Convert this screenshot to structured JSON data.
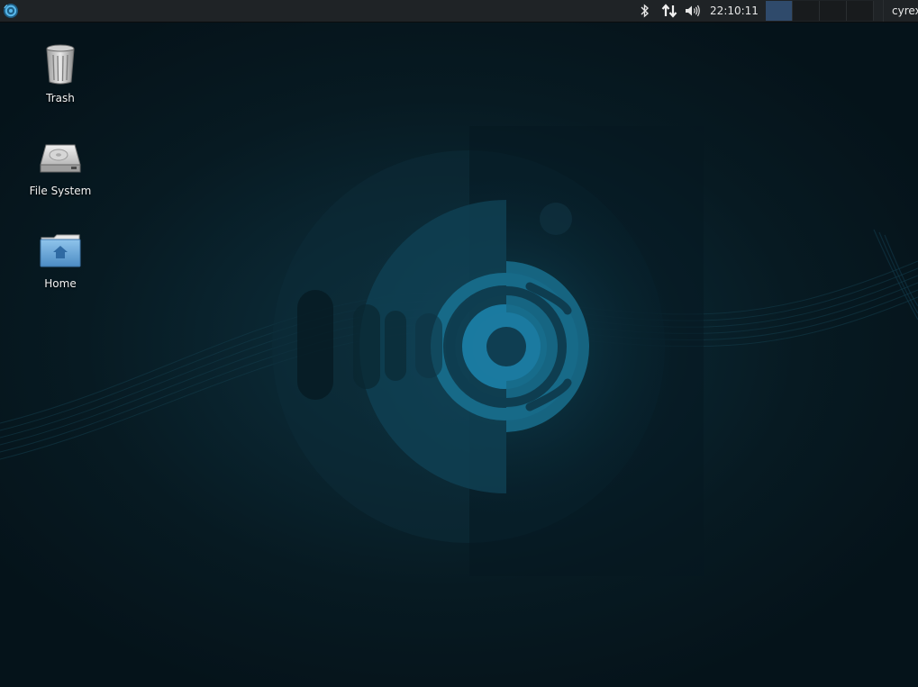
{
  "panel": {
    "menu_icon": "ubuntu-budgie-logo-icon",
    "tray": {
      "bluetooth_icon": "bluetooth-icon",
      "network_icon": "network-transfer-icon",
      "volume_icon": "volume-icon"
    },
    "clock": "22:10:11",
    "workspaces": [
      {
        "name": "workspace-1",
        "active": true
      },
      {
        "name": "workspace-2",
        "active": false
      },
      {
        "name": "workspace-3",
        "active": false
      },
      {
        "name": "workspace-4",
        "active": false
      }
    ],
    "user": "cyrex",
    "colors": {
      "panel_bg": "#1f2326",
      "active_workspace": "#2f4a6b",
      "accent": "#3a9fd6"
    }
  },
  "desktop": {
    "icons": [
      {
        "label": "Trash",
        "icon": "trash-icon"
      },
      {
        "label": "File System",
        "icon": "hard-drive-icon"
      },
      {
        "label": "Home",
        "icon": "home-folder-icon"
      }
    ],
    "wallpaper": {
      "icon": "ubuntu-budgie-wallpaper-logo",
      "colors": {
        "base": "#071a22",
        "logo": "#1a6f8f"
      }
    }
  }
}
